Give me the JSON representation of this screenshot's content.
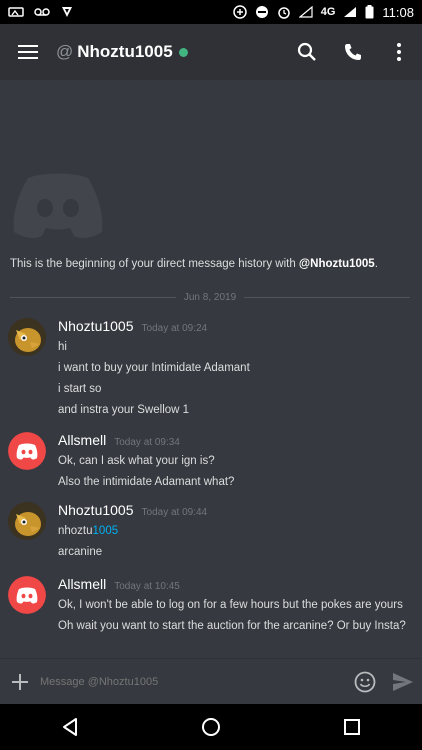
{
  "status_bar": {
    "time": "11:08",
    "network": "4G",
    "left_icons": [
      "voicemail-icon",
      "notification-icon",
      "app-icon"
    ],
    "right_icons": [
      "data-saver-icon",
      "dnd-icon",
      "alarm-icon",
      "signal-icon",
      "battery-icon"
    ]
  },
  "header": {
    "at": "@",
    "title": "Nhoztu1005",
    "status_color": "#43b581",
    "icons": [
      "menu-icon",
      "search-icon",
      "phone-icon",
      "more-icon"
    ]
  },
  "chat": {
    "intro_prefix": "This is the beginning of your direct message history with ",
    "intro_user": "@Nhoztu1005",
    "intro_suffix": ".",
    "date_divider": "Jun 8, 2019",
    "messages": [
      {
        "author": "Nhoztu1005",
        "time": "Today at 09:24",
        "lines": [
          "hi",
          "i want to buy your Intimidate Adamant",
          "i start so",
          "and instra your Swellow 1"
        ]
      },
      {
        "author": "Allsmell",
        "time": "Today at 09:34",
        "lines": [
          "Ok, can I ask what your ign is?",
          "Also the intimidate Adamant what?"
        ]
      },
      {
        "author": "Nhoztu1005",
        "time": "Today at 09:44",
        "lines_pre": "nhoztu",
        "lines_link": "1005",
        "lines": [
          "arcanine"
        ]
      },
      {
        "author": "Allsmell",
        "time": "Today at 10:45",
        "lines": [
          "Ok, I won't be able to log on for a few hours but the pokes are yours",
          "Oh wait you want to start the auction for the arcanine? Or buy Insta?"
        ]
      }
    ]
  },
  "composer": {
    "placeholder": "Message @Nhoztu1005"
  },
  "colors": {
    "background": "#36393f",
    "header": "#2f3136",
    "accent": "#7289da",
    "avatar_red": "#f04747",
    "link": "#00b0f4"
  }
}
